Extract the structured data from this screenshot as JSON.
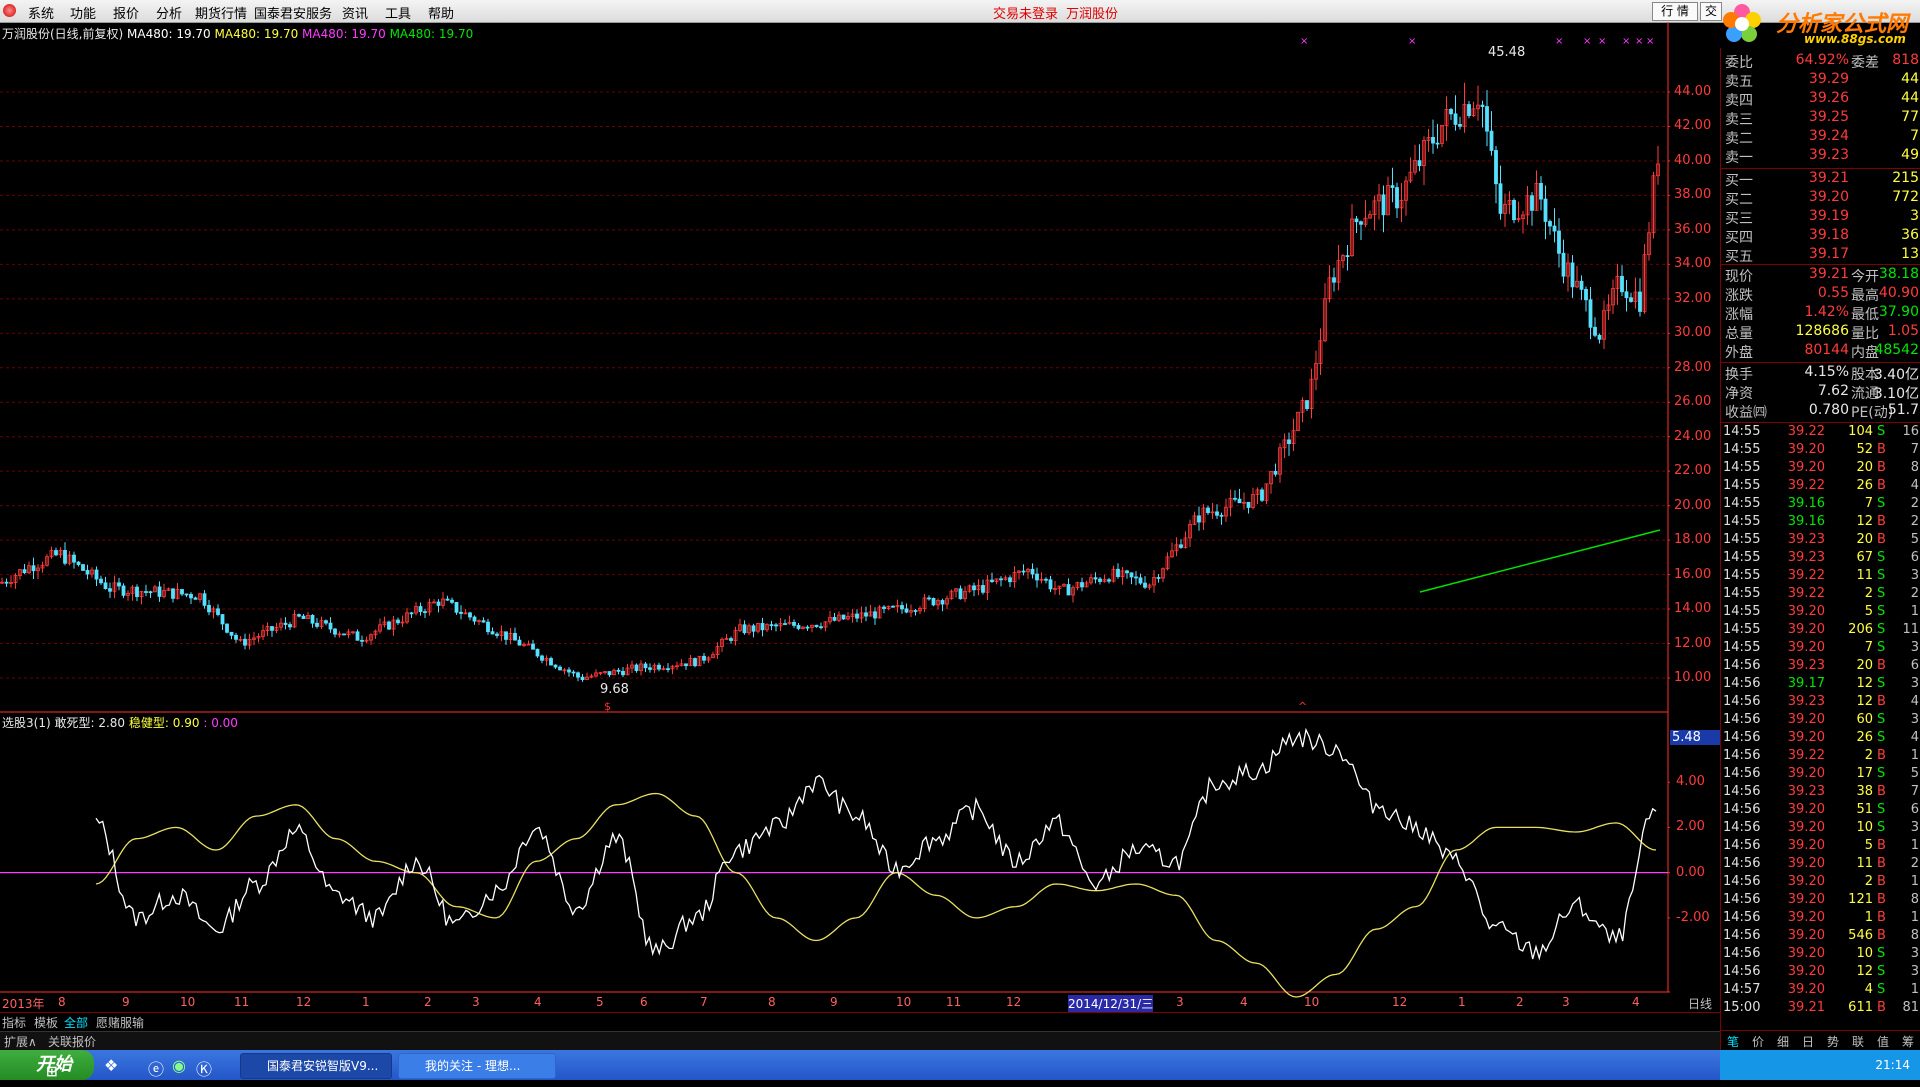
{
  "menubar": {
    "items": [
      "系统",
      "功能",
      "报价",
      "分析",
      "期货行情",
      "国泰君安服务",
      "资讯",
      "工具",
      "帮助"
    ],
    "center_links": [
      "交易未登录",
      "万润股份"
    ],
    "right_buttons": [
      "行 情",
      "交"
    ]
  },
  "brand": {
    "name": "分析家公式网",
    "url": "www.88gs.com"
  },
  "main_chart": {
    "title": "万润股份(日线,前复权)",
    "ma_labels": [
      {
        "text": "MA480: 19.70",
        "color": "#ffffff"
      },
      {
        "text": "MA480: 19.70",
        "color": "#ffff40"
      },
      {
        "text": "MA480: 19.70",
        "color": "#ff3cff"
      },
      {
        "text": "MA480: 19.70",
        "color": "#00e600"
      }
    ],
    "high_label": "45.48",
    "low_label": "9.68",
    "yticks": [
      "44.00",
      "42.00",
      "40.00",
      "38.00",
      "36.00",
      "34.00",
      "32.00",
      "30.00",
      "28.00",
      "26.00",
      "24.00",
      "22.00",
      "20.00",
      "18.00",
      "16.00",
      "14.00",
      "12.00",
      "10.00"
    ]
  },
  "indicator": {
    "name": "选股3(1)",
    "a_label": "敢死型:",
    "a_value": "2.80",
    "b_label": "稳健型:",
    "b_value": "0.90",
    "c_label": ":",
    "c_value": "0.00",
    "current_tag": "5.48",
    "yticks": [
      "4.00",
      "2.00",
      "0.00",
      "-2.00"
    ]
  },
  "chart_data": {
    "type": "line",
    "x_labels": [
      "2013年",
      "8",
      "9",
      "10",
      "11",
      "12",
      "1",
      "2",
      "3",
      "4",
      "5",
      "6",
      "7",
      "8",
      "9",
      "10",
      "11",
      "12",
      "2014/12/31/三",
      "3",
      "4",
      "10",
      "12",
      "1",
      "2",
      "3",
      "4"
    ],
    "series": [
      {
        "name": "敢死型",
        "y": [
          2.2,
          -2.0,
          -1.0,
          -2.5,
          -0.5,
          1.8,
          -1.0,
          -2.0,
          0.5,
          -2.3,
          -0.8,
          2.0,
          -1.5,
          1.5,
          -3.5,
          -2.0,
          1.0,
          2.0,
          4.0,
          2.5,
          0.2,
          1.5,
          2.8,
          0.5,
          2.2,
          -0.5,
          1.0,
          0.5,
          4.0,
          4.5,
          6.0,
          5.5,
          3.0,
          2.0,
          0.5,
          -2.5,
          -3.5,
          -1.5,
          -3.0,
          2.8
        ]
      },
      {
        "name": "稳健型",
        "y": [
          -0.5,
          1.5,
          2.0,
          1.0,
          2.5,
          3.0,
          1.5,
          0.5,
          0.0,
          -1.5,
          -2.0,
          0.5,
          1.5,
          3.0,
          3.5,
          2.5,
          0.0,
          -2.0,
          -3.0,
          -2.0,
          0.0,
          -1.0,
          -2.0,
          -1.5,
          -0.5,
          -0.8,
          -0.5,
          -1.0,
          -3.0,
          -4.0,
          -5.5,
          -4.5,
          -2.5,
          -1.5,
          1.0,
          2.0,
          2.0,
          1.8,
          2.2,
          1.0
        ]
      }
    ],
    "ylim": [
      -5.5,
      6.0
    ]
  },
  "quote": {
    "wei": {
      "label": "委比",
      "value": "64.92%",
      "label2": "委差",
      "value2": "818"
    },
    "asks": [
      {
        "label": "卖五",
        "price": "39.29",
        "vol": "44"
      },
      {
        "label": "卖四",
        "price": "39.26",
        "vol": "44"
      },
      {
        "label": "卖三",
        "price": "39.25",
        "vol": "77"
      },
      {
        "label": "卖二",
        "price": "39.24",
        "vol": "7"
      },
      {
        "label": "卖一",
        "price": "39.23",
        "vol": "49"
      }
    ],
    "bids": [
      {
        "label": "买一",
        "price": "39.21",
        "vol": "215"
      },
      {
        "label": "买二",
        "price": "39.20",
        "vol": "772"
      },
      {
        "label": "买三",
        "price": "39.19",
        "vol": "3"
      },
      {
        "label": "买四",
        "price": "39.18",
        "vol": "36"
      },
      {
        "label": "买五",
        "price": "39.17",
        "vol": "13"
      }
    ],
    "stats": [
      {
        "l1": "现价",
        "v1": "39.21",
        "c1": "red",
        "l2": "今开",
        "v2": "38.18",
        "c2": "green"
      },
      {
        "l1": "涨跌",
        "v1": "0.55",
        "c1": "red",
        "l2": "最高",
        "v2": "40.90",
        "c2": "red"
      },
      {
        "l1": "涨幅",
        "v1": "1.42%",
        "c1": "red",
        "l2": "最低",
        "v2": "37.90",
        "c2": "green"
      },
      {
        "l1": "总量",
        "v1": "128686",
        "c1": "yellow",
        "l2": "量比",
        "v2": "1.05",
        "c2": "red"
      },
      {
        "l1": "外盘",
        "v1": "80144",
        "c1": "red",
        "l2": "内盘",
        "v2": "48542",
        "c2": "green"
      },
      {
        "l1": "换手",
        "v1": "4.15%",
        "c1": "white",
        "l2": "股本",
        "v2": "3.40亿",
        "c2": "white"
      },
      {
        "l1": "净资",
        "v1": "7.62",
        "c1": "white",
        "l2": "流通",
        "v2": "3.10亿",
        "c2": "white"
      },
      {
        "l1": "收益㈣",
        "v1": "0.780",
        "c1": "white",
        "l2": "PE(动)",
        "v2": "51.7",
        "c2": "white"
      }
    ],
    "ticks": [
      {
        "t": "14:55",
        "p": "39.22",
        "v": "104",
        "d": "S",
        "n": "16"
      },
      {
        "t": "14:55",
        "p": "39.20",
        "v": "52",
        "d": "B",
        "n": "7"
      },
      {
        "t": "14:55",
        "p": "39.20",
        "v": "20",
        "d": "B",
        "n": "8"
      },
      {
        "t": "14:55",
        "p": "39.22",
        "v": "26",
        "d": "B",
        "n": "4"
      },
      {
        "t": "14:55",
        "p": "39.16",
        "v": "7",
        "d": "S",
        "n": "2"
      },
      {
        "t": "14:55",
        "p": "39.16",
        "v": "12",
        "d": "B",
        "n": "2"
      },
      {
        "t": "14:55",
        "p": "39.23",
        "v": "20",
        "d": "B",
        "n": "5"
      },
      {
        "t": "14:55",
        "p": "39.23",
        "v": "67",
        "d": "S",
        "n": "6"
      },
      {
        "t": "14:55",
        "p": "39.22",
        "v": "11",
        "d": "S",
        "n": "3"
      },
      {
        "t": "14:55",
        "p": "39.22",
        "v": "2",
        "d": "S",
        "n": "2"
      },
      {
        "t": "14:55",
        "p": "39.20",
        "v": "5",
        "d": "S",
        "n": "1"
      },
      {
        "t": "14:55",
        "p": "39.20",
        "v": "206",
        "d": "S",
        "n": "11"
      },
      {
        "t": "14:55",
        "p": "39.20",
        "v": "7",
        "d": "S",
        "n": "3"
      },
      {
        "t": "14:56",
        "p": "39.23",
        "v": "20",
        "d": "B",
        "n": "6"
      },
      {
        "t": "14:56",
        "p": "39.17",
        "v": "12",
        "d": "S",
        "n": "3"
      },
      {
        "t": "14:56",
        "p": "39.23",
        "v": "12",
        "d": "B",
        "n": "4"
      },
      {
        "t": "14:56",
        "p": "39.20",
        "v": "60",
        "d": "S",
        "n": "3"
      },
      {
        "t": "14:56",
        "p": "39.20",
        "v": "26",
        "d": "S",
        "n": "4"
      },
      {
        "t": "14:56",
        "p": "39.22",
        "v": "2",
        "d": "B",
        "n": "1"
      },
      {
        "t": "14:56",
        "p": "39.20",
        "v": "17",
        "d": "S",
        "n": "5"
      },
      {
        "t": "14:56",
        "p": "39.23",
        "v": "38",
        "d": "B",
        "n": "7"
      },
      {
        "t": "14:56",
        "p": "39.20",
        "v": "51",
        "d": "S",
        "n": "6"
      },
      {
        "t": "14:56",
        "p": "39.20",
        "v": "10",
        "d": "S",
        "n": "3"
      },
      {
        "t": "14:56",
        "p": "39.20",
        "v": "5",
        "d": "B",
        "n": "1"
      },
      {
        "t": "14:56",
        "p": "39.20",
        "v": "11",
        "d": "B",
        "n": "2"
      },
      {
        "t": "14:56",
        "p": "39.20",
        "v": "2",
        "d": "B",
        "n": "1"
      },
      {
        "t": "14:56",
        "p": "39.20",
        "v": "121",
        "d": "B",
        "n": "8"
      },
      {
        "t": "14:56",
        "p": "39.20",
        "v": "1",
        "d": "B",
        "n": "1"
      },
      {
        "t": "14:56",
        "p": "39.20",
        "v": "546",
        "d": "B",
        "n": "8"
      },
      {
        "t": "14:56",
        "p": "39.20",
        "v": "10",
        "d": "S",
        "n": "3"
      },
      {
        "t": "14:56",
        "p": "39.20",
        "v": "12",
        "d": "S",
        "n": "3"
      },
      {
        "t": "14:57",
        "p": "39.20",
        "v": "4",
        "d": "S",
        "n": "1"
      },
      {
        "t": "15:00",
        "p": "39.21",
        "v": "611",
        "d": "B",
        "n": "81"
      }
    ],
    "panel_tabs": [
      "笔",
      "价",
      "细",
      "日",
      "势",
      "联",
      "值",
      "筹"
    ]
  },
  "bottom": {
    "tabs": [
      "指标",
      "模板",
      "全部",
      "愿赌服输"
    ],
    "tabs2": [
      "扩展∧",
      "关联报价"
    ],
    "period": "日线"
  },
  "taskbar": {
    "start": "开始",
    "tasks": [
      "国泰君安锐智版V9...",
      "我的关注 - 理想..."
    ],
    "clock": "21:14",
    "colors": {
      "bar": "#2456c9",
      "start": "#2f9e2f",
      "tray": "#1596e6"
    }
  },
  "colors": {
    "up": "#ff3b3b",
    "down": "#55e0ff",
    "grid": "#7a0000",
    "axis": "#ff3b3b"
  }
}
